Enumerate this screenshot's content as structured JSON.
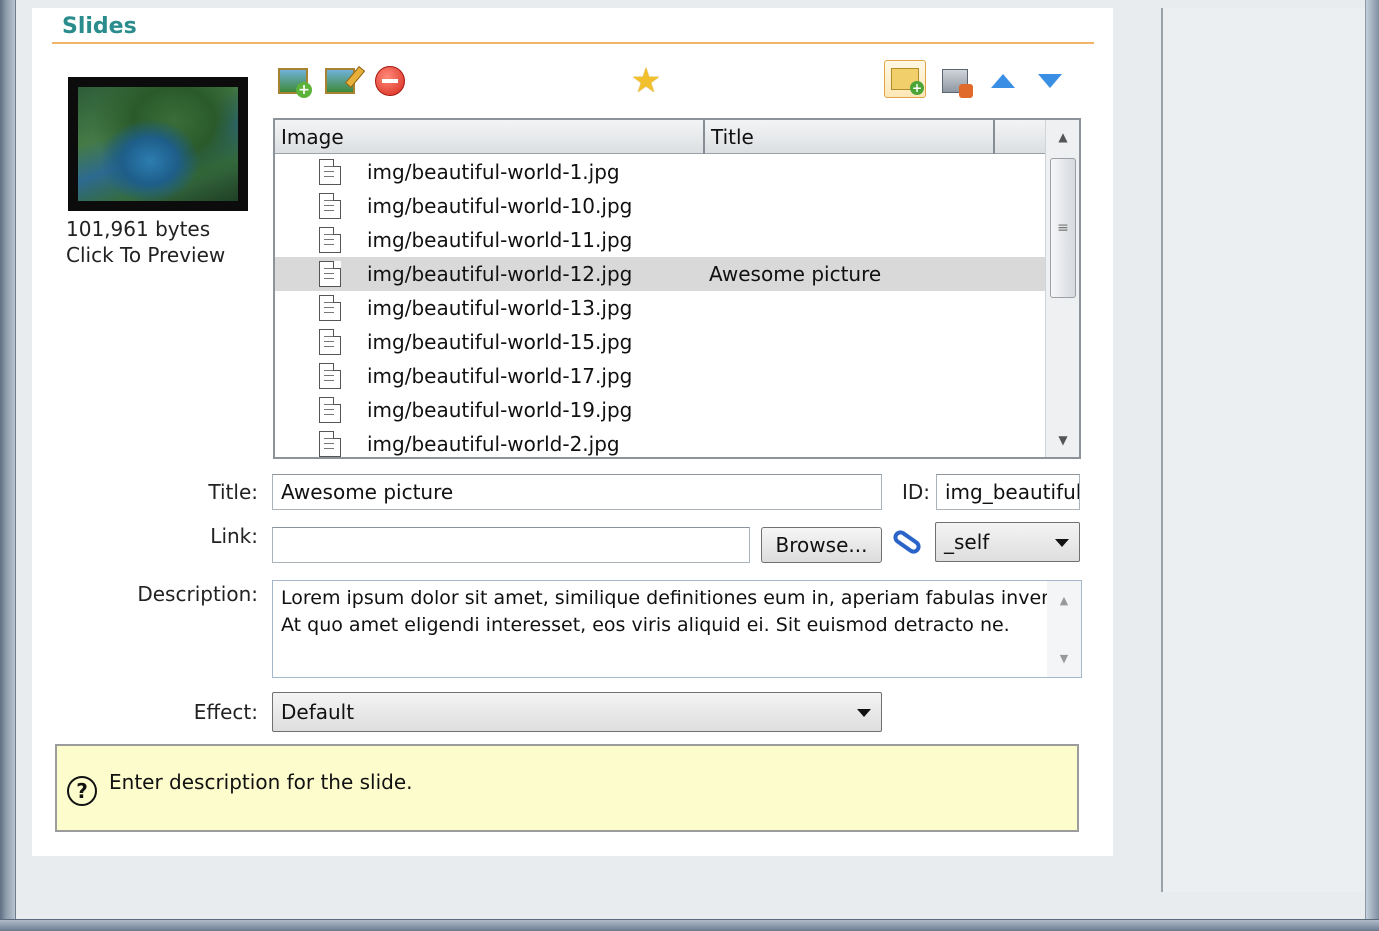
{
  "section": {
    "title": "Slides"
  },
  "preview": {
    "size": "101,961 bytes",
    "hint": "Click To Preview"
  },
  "icons": {
    "add": "add-image-icon",
    "edit": "edit-image-icon",
    "delete": "delete-icon",
    "star": "star-icon",
    "folder": "add-folder-icon",
    "package": "package-icon",
    "move_up": "arrow-up-icon",
    "move_down": "arrow-down-icon"
  },
  "list": {
    "columns": {
      "image": "Image",
      "title": "Title"
    },
    "rows": [
      {
        "image": "img/beautiful-world-1.jpg",
        "title": ""
      },
      {
        "image": "img/beautiful-world-10.jpg",
        "title": ""
      },
      {
        "image": "img/beautiful-world-11.jpg",
        "title": ""
      },
      {
        "image": "img/beautiful-world-12.jpg",
        "title": "Awesome picture"
      },
      {
        "image": "img/beautiful-world-13.jpg",
        "title": ""
      },
      {
        "image": "img/beautiful-world-15.jpg",
        "title": ""
      },
      {
        "image": "img/beautiful-world-17.jpg",
        "title": ""
      },
      {
        "image": "img/beautiful-world-19.jpg",
        "title": ""
      },
      {
        "image": "img/beautiful-world-2.jpg",
        "title": ""
      }
    ]
  },
  "form": {
    "title_label": "Title:",
    "title_value": "Awesome picture",
    "id_label": "ID:",
    "id_value": "img_beautiful",
    "link_label": "Link:",
    "link_value": "",
    "browse_label": "Browse...",
    "target_value": "_self",
    "description_label": "Description:",
    "description_line1": "Lorem ipsum dolor sit amet, similique definitiones eum in, aperiam fabulas inveni",
    "description_line2": "At quo amet eligendi interesset, eos viris aliquid ei. Sit euismod detracto ne.",
    "effect_label": "Effect:",
    "effect_value": "Default"
  },
  "help": {
    "icon": "?",
    "text": "Enter description for the slide."
  },
  "colors": {
    "accent": "#2a8c8c",
    "rule": "#f1b46b",
    "help_bg": "#fcfccd",
    "selected_row": "#d9d9d9"
  }
}
